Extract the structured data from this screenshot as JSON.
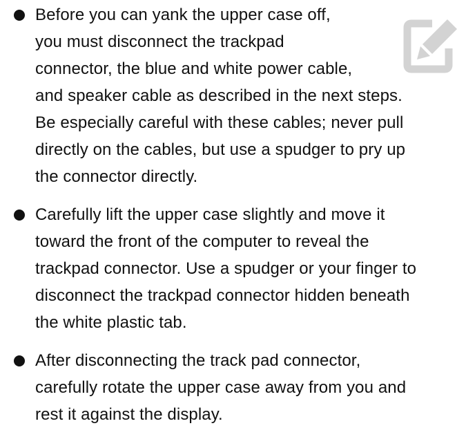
{
  "steps": [
    {
      "text": "Before you can yank the upper case off,\nyou must disconnect the trackpad\nconnector, the blue and white power cable,\nand speaker cable as described in the next steps.\nBe especially careful with these cables; never pull\ndirectly on the cables, but use a spudger to pry up\nthe connector directly."
    },
    {
      "text": "Carefully lift the upper case slightly and move it\ntoward the front of the computer to reveal the\ntrackpad connector. Use a spudger or your finger to\ndisconnect the trackpad connector hidden beneath\nthe white plastic tab."
    },
    {
      "text": "After disconnecting the track pad connector,\ncarefully rotate the upper case away from you and\nrest it against the display."
    }
  ],
  "icons": {
    "edit": "edit-icon"
  },
  "colors": {
    "text": "#111111",
    "icon": "#d3d3d3",
    "background": "#ffffff"
  }
}
